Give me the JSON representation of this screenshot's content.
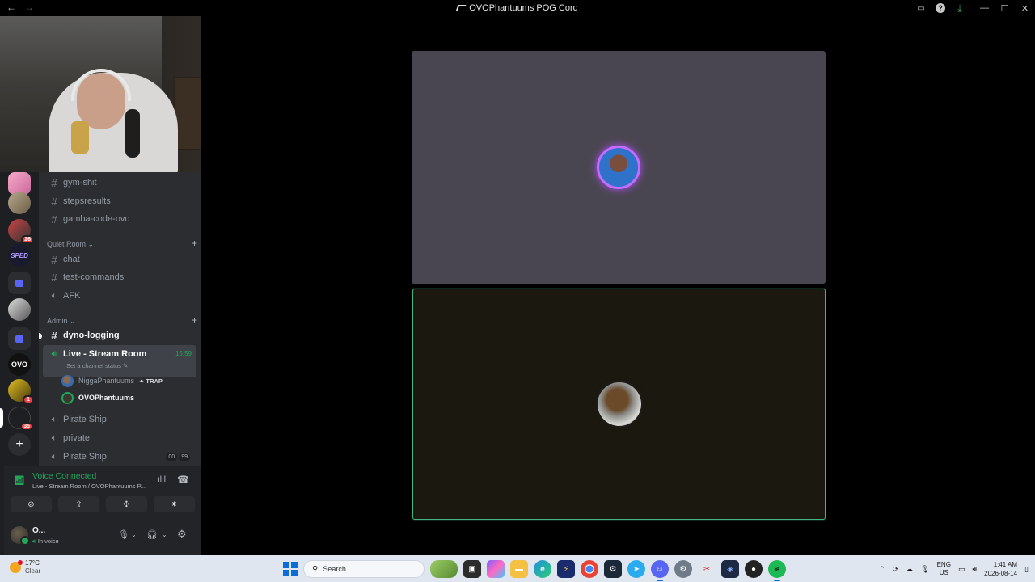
{
  "window": {
    "title": "OVOPhantuums POG Cord",
    "nav_back": "←",
    "nav_forward": "→"
  },
  "channels": {
    "text_top": [
      "gym-shit",
      "stepsresults",
      "gamba-code-ovo"
    ],
    "categories": {
      "quiet_room": "Quiet Room",
      "admin": "Admin"
    },
    "quiet_room_items": [
      "chat",
      "test-commands",
      "AFK"
    ],
    "admin_text": "dyno-logging",
    "active_voice": {
      "name": "Live - Stream Room",
      "time": "15:59",
      "status": "Set a channel status"
    },
    "members": [
      {
        "name": "NiggaPhantuums",
        "tag": "TRAP"
      },
      {
        "name": "OVOPhantuums",
        "tag": ""
      }
    ],
    "voice_after": [
      "Pirate Ship",
      "private",
      "Pirate Ship"
    ],
    "pirate_badges": [
      "00",
      "99"
    ]
  },
  "servers": {
    "badges": [
      "26",
      "1",
      "35"
    ],
    "labels": [
      "SPED",
      "OVO"
    ]
  },
  "voice_panel": {
    "title": "Voice Connected",
    "subtitle": "Live - Stream Room / OVOPhantuums P..."
  },
  "user_panel": {
    "name": "O...",
    "status": "In voice"
  },
  "taskbar": {
    "temperature": "17°C",
    "weather": "Clear",
    "search_placeholder": "Search",
    "lang_top": "ENG",
    "lang_bottom": "US",
    "time": "1:41 AM",
    "date": "2026-08-14"
  },
  "colors": {
    "accent_green": "#23a55a",
    "speaking_ring": "#c56bff",
    "blurple": "#5865f2"
  }
}
